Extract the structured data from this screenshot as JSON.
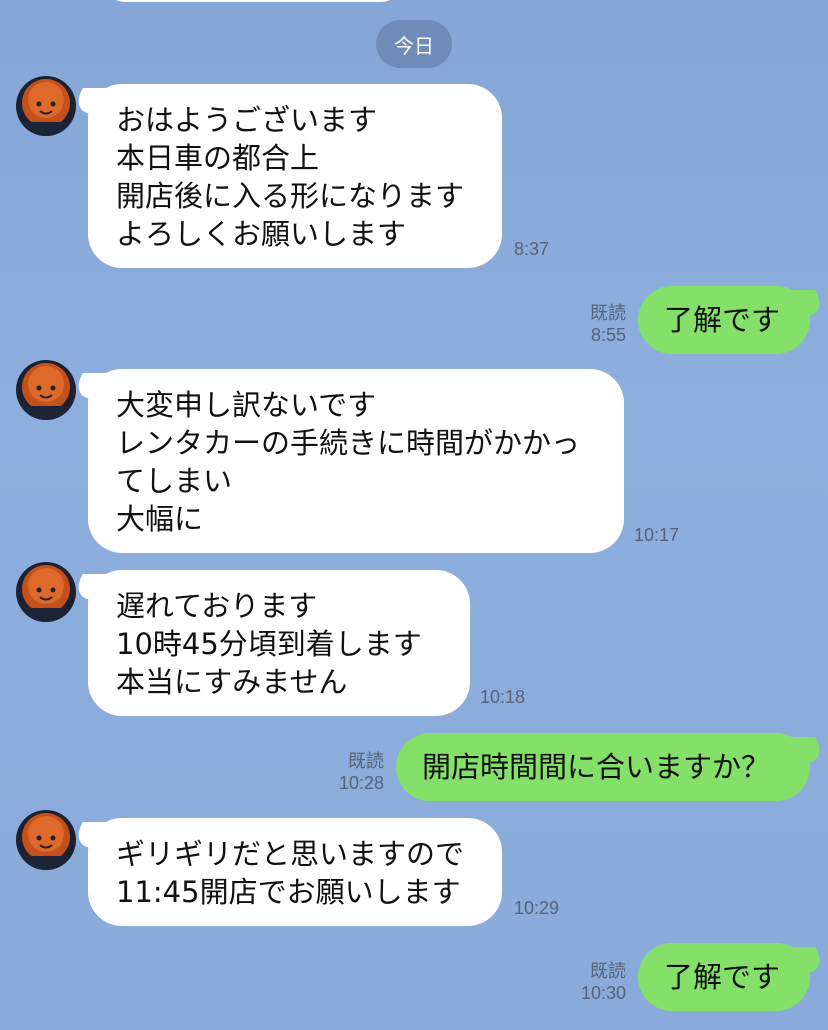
{
  "date_separator": "今日",
  "messages": [
    {
      "lines": [
        "おはようございます",
        "本日車の都合上",
        "開店後に入る形になります",
        "よろしくお願いします"
      ],
      "time": "8:37"
    },
    {
      "text": "了解です",
      "read": "既読",
      "time": "8:55"
    },
    {
      "lines": [
        "大変申し訳ないです",
        "レンタカーの手続きに時間がかかっ",
        "てしまい",
        "大幅に"
      ],
      "time": "10:17"
    },
    {
      "lines": [
        "遅れております",
        "10時45分頃到着します",
        "本当にすみません"
      ],
      "time": "10:18"
    },
    {
      "text": "開店時間間に合いますか？",
      "read": "既読",
      "time": "10:28"
    },
    {
      "lines": [
        "ギリギリだと思いますので",
        "11:45開店でお願いします"
      ],
      "time": "10:29"
    },
    {
      "text": "了解です",
      "read": "既読",
      "time": "10:30"
    }
  ],
  "colors": {
    "background": "#8aaad9",
    "outgoing": "#85e06a",
    "incoming": "#ffffff",
    "date_pill": "#6f8bb7"
  }
}
